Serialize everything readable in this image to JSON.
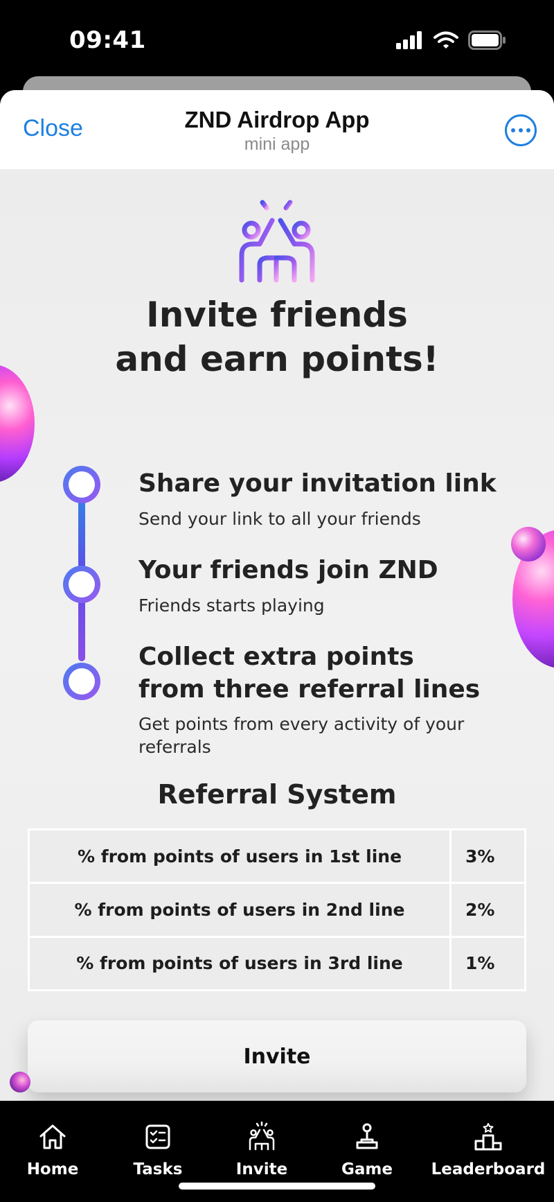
{
  "status_bar": {
    "time": "09:41"
  },
  "header": {
    "close_label": "Close",
    "title": "ZND Airdrop App",
    "subtitle": "mini app"
  },
  "hero": {
    "icon": "high-five-icon",
    "title_line1": "Invite friends",
    "title_line2": "and earn points!"
  },
  "steps": [
    {
      "title": "Share your invitation link",
      "description": "Send your link to all your friends"
    },
    {
      "title_line1": "Your friends join ZND",
      "description": "Friends starts playing"
    },
    {
      "title_line1": "Collect extra points",
      "title_line2": "from three referral lines",
      "description_line1": "Get points from every activity of your",
      "description_line2": "referrals"
    }
  ],
  "referral": {
    "heading": "Referral System",
    "rows": [
      {
        "label": "% from points of users in 1st line",
        "value": "3%"
      },
      {
        "label": "% from points of users in 2nd line",
        "value": "2%"
      },
      {
        "label": "% from points of users in 3rd line",
        "value": "1%"
      }
    ]
  },
  "invite_button": "Invite",
  "tabs": [
    {
      "label": "Home",
      "icon": "home-icon"
    },
    {
      "label": "Tasks",
      "icon": "tasks-icon"
    },
    {
      "label": "Invite",
      "icon": "invite-icon"
    },
    {
      "label": "Game",
      "icon": "joystick-icon"
    },
    {
      "label": "Leaderboard",
      "icon": "podium-icon"
    }
  ],
  "colors": {
    "accent_blue": "#1d7fe0",
    "gradient_start": "#4b7bef",
    "gradient_end": "#e89af0"
  }
}
